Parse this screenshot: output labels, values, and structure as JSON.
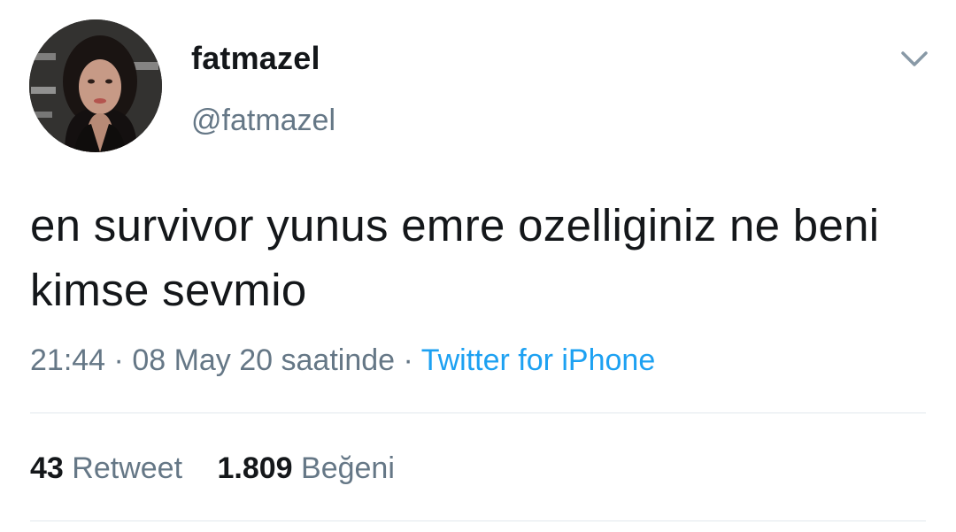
{
  "user": {
    "display_name": "fatmazel",
    "handle": "@fatmazel",
    "avatar_icon": "profile-photo"
  },
  "tweet": {
    "text": "en survivor yunus emre ozelliginiz ne beni kimse sevmio"
  },
  "meta": {
    "time": "21:44",
    "separator": " · ",
    "date": "08 May 20 saatinde",
    "source": "Twitter for iPhone"
  },
  "stats": {
    "retweet_count": "43",
    "retweet_label": "Retweet",
    "like_count": "1.809",
    "like_label": "Beğeni"
  },
  "icons": {
    "caret": "chevron-down-icon"
  },
  "colors": {
    "text": "#14171a",
    "secondary": "#657786",
    "link": "#1da1f2",
    "divider": "#e1e8ed"
  }
}
